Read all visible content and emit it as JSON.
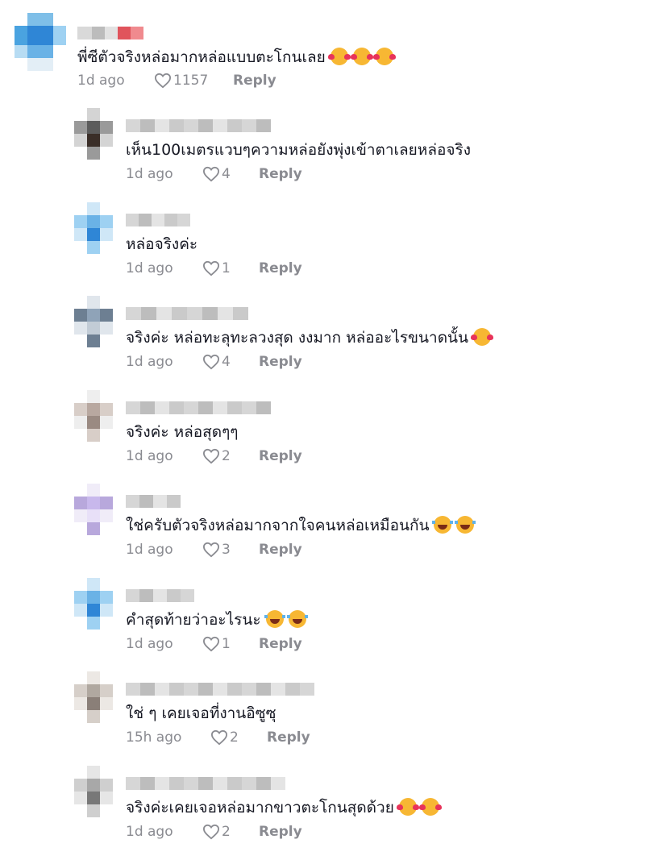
{
  "colors": {
    "text": "#161823",
    "meta": "#8a8b91",
    "background": "#ffffff"
  },
  "comments": [
    {
      "text": "พี่ซีตัวจริงหล่อมากหล่อแบบตะโกนเลย",
      "emoji": [
        "smiling-face-with-hearts",
        "smiling-face-with-hearts",
        "smiling-face-with-hearts"
      ],
      "time": "1d ago",
      "likes": "1157",
      "reply": "Reply",
      "level": "top"
    },
    {
      "text": "เห็น100เมตรแวบๆความหล่อยังพุ่งเข้าตาเลยหล่อจริง",
      "emoji": [],
      "time": "1d ago",
      "likes": "4",
      "reply": "Reply",
      "level": "reply"
    },
    {
      "text": "หล่อจริงค่ะ",
      "emoji": [],
      "time": "1d ago",
      "likes": "1",
      "reply": "Reply",
      "level": "reply"
    },
    {
      "text": "จริงค่ะ หล่อทะลุทะลวงสุด งงมาก หล่ออะไรขนาดนั้น",
      "emoji": [
        "smiling-face-with-hearts"
      ],
      "time": "1d ago",
      "likes": "4",
      "reply": "Reply",
      "level": "reply"
    },
    {
      "text": "จริงค่ะ หล่อสุดๆๆ",
      "emoji": [],
      "time": "1d ago",
      "likes": "2",
      "reply": "Reply",
      "level": "reply"
    },
    {
      "text": "ใช่ครับตัวจริงหล่อมากจากใจคนหล่อเหมือนกัน",
      "emoji": [
        "face-with-tears-of-joy",
        "face-with-tears-of-joy"
      ],
      "time": "1d ago",
      "likes": "3",
      "reply": "Reply",
      "level": "reply"
    },
    {
      "text": "คำสุดท้ายว่าอะไรนะ",
      "emoji": [
        "face-with-tears-of-joy",
        "face-with-tears-of-joy"
      ],
      "time": "1d ago",
      "likes": "1",
      "reply": "Reply",
      "level": "reply"
    },
    {
      "text": "ใช่ ๆ เคยเจอที่งานอิซูซุ",
      "emoji": [],
      "time": "15h ago",
      "likes": "2",
      "reply": "Reply",
      "level": "reply"
    },
    {
      "text": "จริงค่ะเคยเจอหล่อมากขาวตะโกนสุดด้วย",
      "emoji": [
        "smiling-face-with-hearts",
        "smiling-face-with-hearts"
      ],
      "time": "1d ago",
      "likes": "2",
      "reply": "Reply",
      "level": "reply"
    }
  ]
}
